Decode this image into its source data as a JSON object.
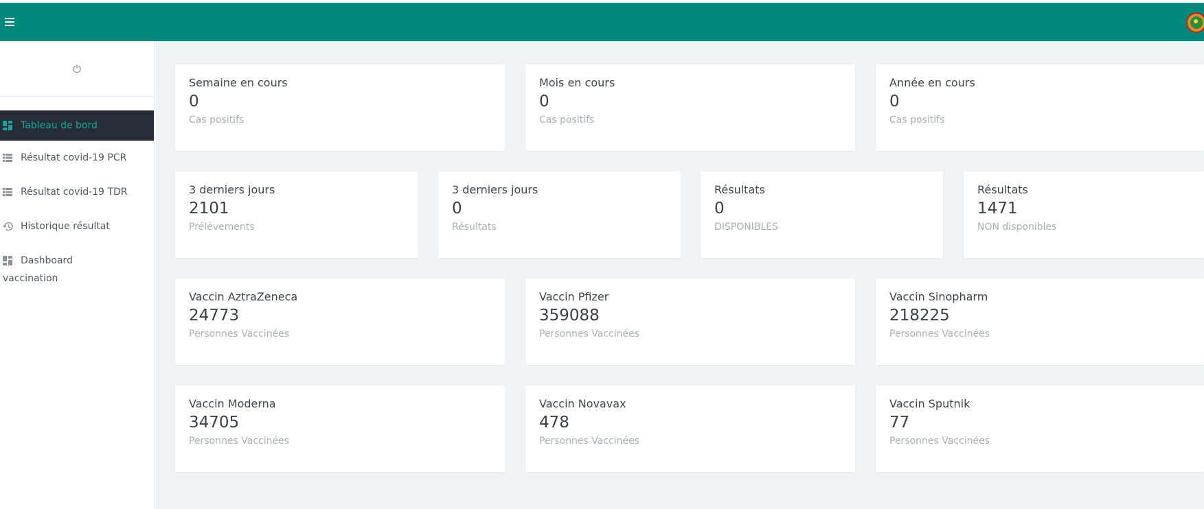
{
  "header": {
    "menu_icon": "hamburger-icon",
    "avatar_icon": "emblem-avatar",
    "bg_color": "#03887c"
  },
  "sidebar": {
    "power_icon": "power-icon",
    "items": [
      {
        "label": "Tableau de bord",
        "icon": "dashboard-icon",
        "active": true
      },
      {
        "label": "Résultat covid-19 PCR",
        "icon": "list-icon"
      },
      {
        "label": "Résultat covid-19 TDR",
        "icon": "list-icon"
      },
      {
        "label": "Historique résultat",
        "icon": "history-icon"
      },
      {
        "label_line1": "Dashboard",
        "label_line2": "vaccination",
        "icon": "dashboard-icon"
      }
    ],
    "active_bg": "#262d38",
    "active_color": "#16a59a"
  },
  "cards": {
    "week": {
      "title": "Semaine en cours",
      "value": "0",
      "sub": "Cas positifs"
    },
    "month": {
      "title": "Mois en cours",
      "value": "0",
      "sub": "Cas positifs"
    },
    "year": {
      "title": "Année en cours",
      "value": "0",
      "sub": "Cas positifs"
    },
    "samples3d": {
      "title": "3 derniers jours",
      "value": "2101",
      "sub": "Prélèvements"
    },
    "results3d": {
      "title": "3 derniers jours",
      "value": "0",
      "sub": "Résultats"
    },
    "available": {
      "title": "Résultats",
      "value": "0",
      "sub": "DISPONIBLES"
    },
    "unavailable": {
      "title": "Résultats",
      "value": "1471",
      "sub": "NON disponibles"
    },
    "astrazeneca": {
      "title": "Vaccin AztraZeneca",
      "value": "24773",
      "sub": "Personnes Vaccinées"
    },
    "pfizer": {
      "title": "Vaccin Pfizer",
      "value": "359088",
      "sub": "Personnes Vaccinées"
    },
    "sinopharm": {
      "title": "Vaccin Sinopharm",
      "value": "218225",
      "sub": "Personnes Vaccinées"
    },
    "moderna": {
      "title": "Vaccin Moderna",
      "value": "34705",
      "sub": "Personnes Vaccinées"
    },
    "novavax": {
      "title": "Vaccin Novavax",
      "value": "478",
      "sub": "Personnes Vaccinées"
    },
    "sputnik": {
      "title": "Vaccin Sputnik",
      "value": "77",
      "sub": "Personnes Vaccinées"
    }
  }
}
